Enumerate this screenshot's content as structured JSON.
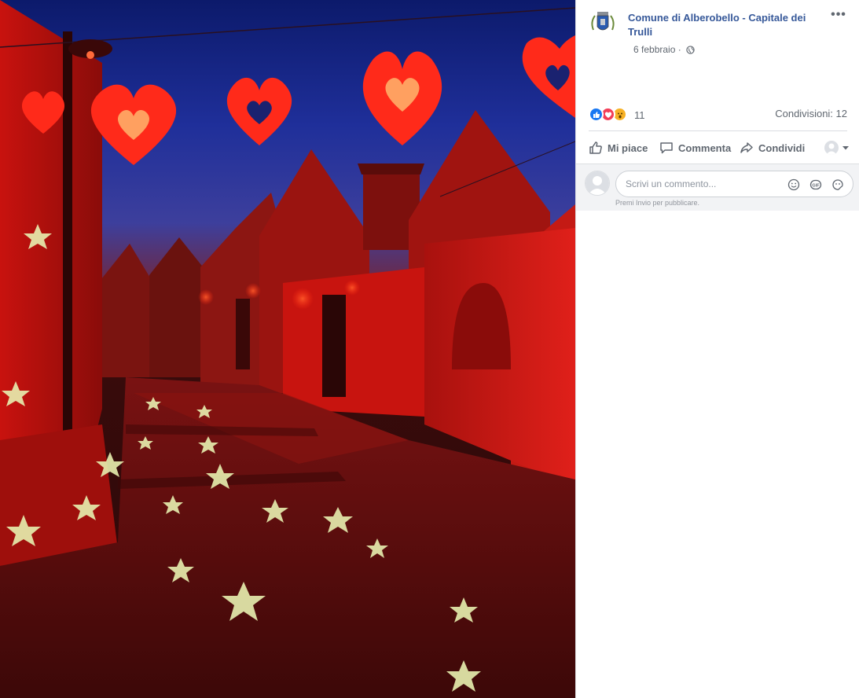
{
  "post": {
    "page_name": "Comune di Alberobello - Capitale dei Trulli",
    "date": "6 febbraio",
    "more_label": "•••"
  },
  "stats": {
    "reaction_count": "11",
    "shares": "Condivisioni: 12"
  },
  "actions": {
    "like": "Mi piace",
    "comment": "Commenta",
    "share": "Condividi"
  },
  "comment": {
    "placeholder": "Scrivi un commento...",
    "hint": "Premi Invio per pubblicare."
  },
  "colors": {
    "link": "#365899",
    "like": "#1877f2",
    "love": "#f33e58",
    "wow": "#f7b125"
  },
  "icons": [
    "globe-icon",
    "like-icon",
    "comment-icon",
    "share-icon",
    "emoji-icon",
    "gif-icon",
    "sticker-icon",
    "chevron-down-icon"
  ]
}
